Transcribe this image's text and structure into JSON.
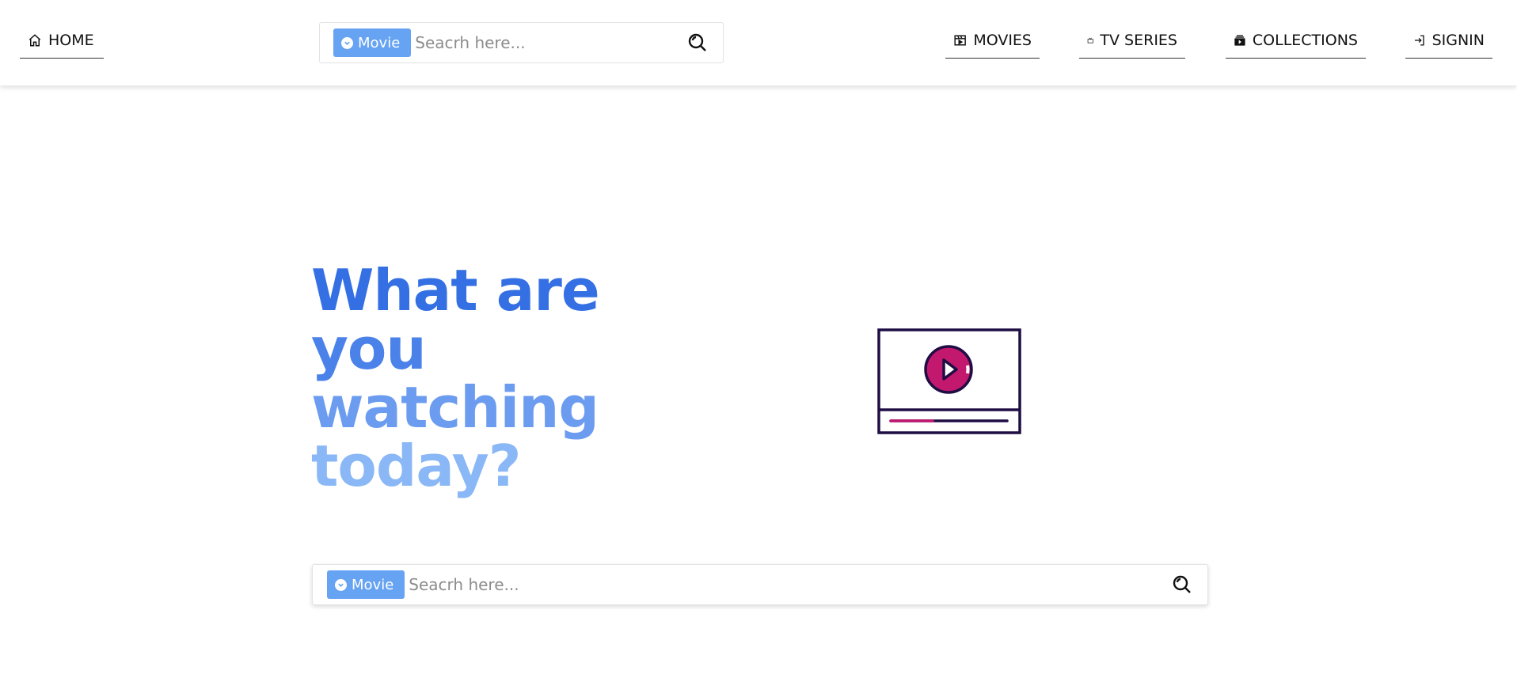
{
  "nav": {
    "home": "HOME",
    "movies": "MOVIES",
    "tv_series": "TV SERIES",
    "collections": "COLLECTIONS",
    "signin": "SIGNIN"
  },
  "search_top": {
    "type_label": "Movie",
    "placeholder": "Seacrh here..."
  },
  "hero": {
    "line1": "What are",
    "line2": "you",
    "line3": "watching",
    "line4": "today?"
  },
  "search_main": {
    "type_label": "Movie",
    "placeholder": "Seacrh here..."
  },
  "colors": {
    "accent": "#66a3f2",
    "title_dark": "#3470e4",
    "title_light": "#8ab7f5",
    "play_magenta": "#c2186d",
    "outline": "#1f0d44"
  }
}
